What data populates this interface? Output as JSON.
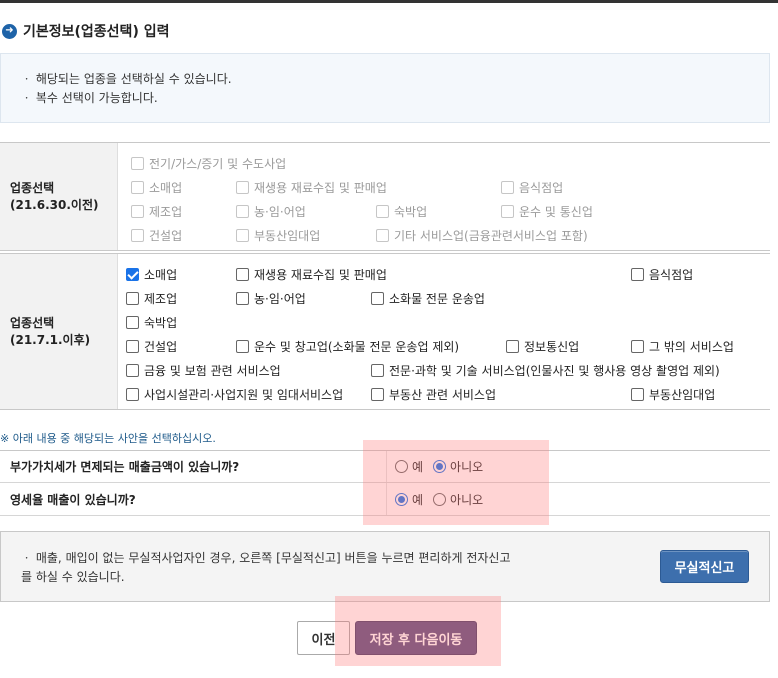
{
  "heading": {
    "icon": "arrow-right-circle-icon",
    "title": "기본정보(업종선택) 입력"
  },
  "notice": {
    "line1": "ㆍ 해당되는 업종을 선택하실 수 있습니다.",
    "line2": "ㆍ 복수 선택이 가능합니다."
  },
  "group1": {
    "label": "업종선택",
    "label_sub": "(21.6.30.이전)",
    "options": [
      {
        "label": "전기/가스/증기 및 수도사업",
        "checked": false
      },
      {
        "label": "소매업",
        "checked": false
      },
      {
        "label": "재생용 재료수집 및 판매업",
        "checked": false
      },
      {
        "label": "음식점업",
        "checked": false
      },
      {
        "label": "제조업",
        "checked": false
      },
      {
        "label": "농·임·어업",
        "checked": false
      },
      {
        "label": "숙박업",
        "checked": false
      },
      {
        "label": "운수 및 통신업",
        "checked": false
      },
      {
        "label": "건설업",
        "checked": false
      },
      {
        "label": "부동산임대업",
        "checked": false
      },
      {
        "label": "기타 서비스업(금융관련서비스업 포함)",
        "checked": false
      }
    ]
  },
  "group2": {
    "label": "업종선택",
    "label_sub": "(21.7.1.이후)",
    "options": [
      {
        "label": "소매업",
        "checked": true
      },
      {
        "label": "재생용 재료수집 및 판매업",
        "checked": false
      },
      {
        "label": "음식점업",
        "checked": false
      },
      {
        "label": "제조업",
        "checked": false
      },
      {
        "label": "농·임·어업",
        "checked": false
      },
      {
        "label": "소화물 전문 운송업",
        "checked": false
      },
      {
        "label": "숙박업",
        "checked": false
      },
      {
        "label": "건설업",
        "checked": false
      },
      {
        "label": "운수 및 창고업(소화물 전문 운송업 제외)",
        "checked": false
      },
      {
        "label": "정보통신업",
        "checked": false
      },
      {
        "label": "그 밖의 서비스업",
        "checked": false
      },
      {
        "label": "금융 및 보험 관련 서비스업",
        "checked": false
      },
      {
        "label": "전문·과학 및 기술 서비스업(인물사진 및 행사용 영상 촬영업 제외)",
        "checked": false
      },
      {
        "label": "사업시설관리·사업지원 및 임대서비스업",
        "checked": false
      },
      {
        "label": "부동산 관련 서비스업",
        "checked": false
      },
      {
        "label": "부동산임대업",
        "checked": false
      }
    ]
  },
  "note": "※ 아래 내용 중 해당되는 사안을 선택하십시오.",
  "questions": [
    {
      "text": "부가가치세가 면제되는 매출금액이 있습니까?",
      "yes": "예",
      "no": "아니오",
      "selected": "no"
    },
    {
      "text": "영세율 매출이 있습니까?",
      "yes": "예",
      "no": "아니오",
      "selected": "yes"
    }
  ],
  "info_box": {
    "text": "ㆍ 매출, 매입이 없는 무실적사업자인 경우, 오른쪽 [무실적신고] 버튼을 누르면 편리하게 전자신고를 하실 수 있습니다.",
    "button": "무실적신고"
  },
  "footer": {
    "prev": "이전",
    "next": "저장 후 다음이동"
  },
  "colors": {
    "accent_blue": "#1a73e8",
    "primary_button": "#5a4f80",
    "secondary_button": "#3d6fad",
    "highlight": "#ff7878"
  }
}
